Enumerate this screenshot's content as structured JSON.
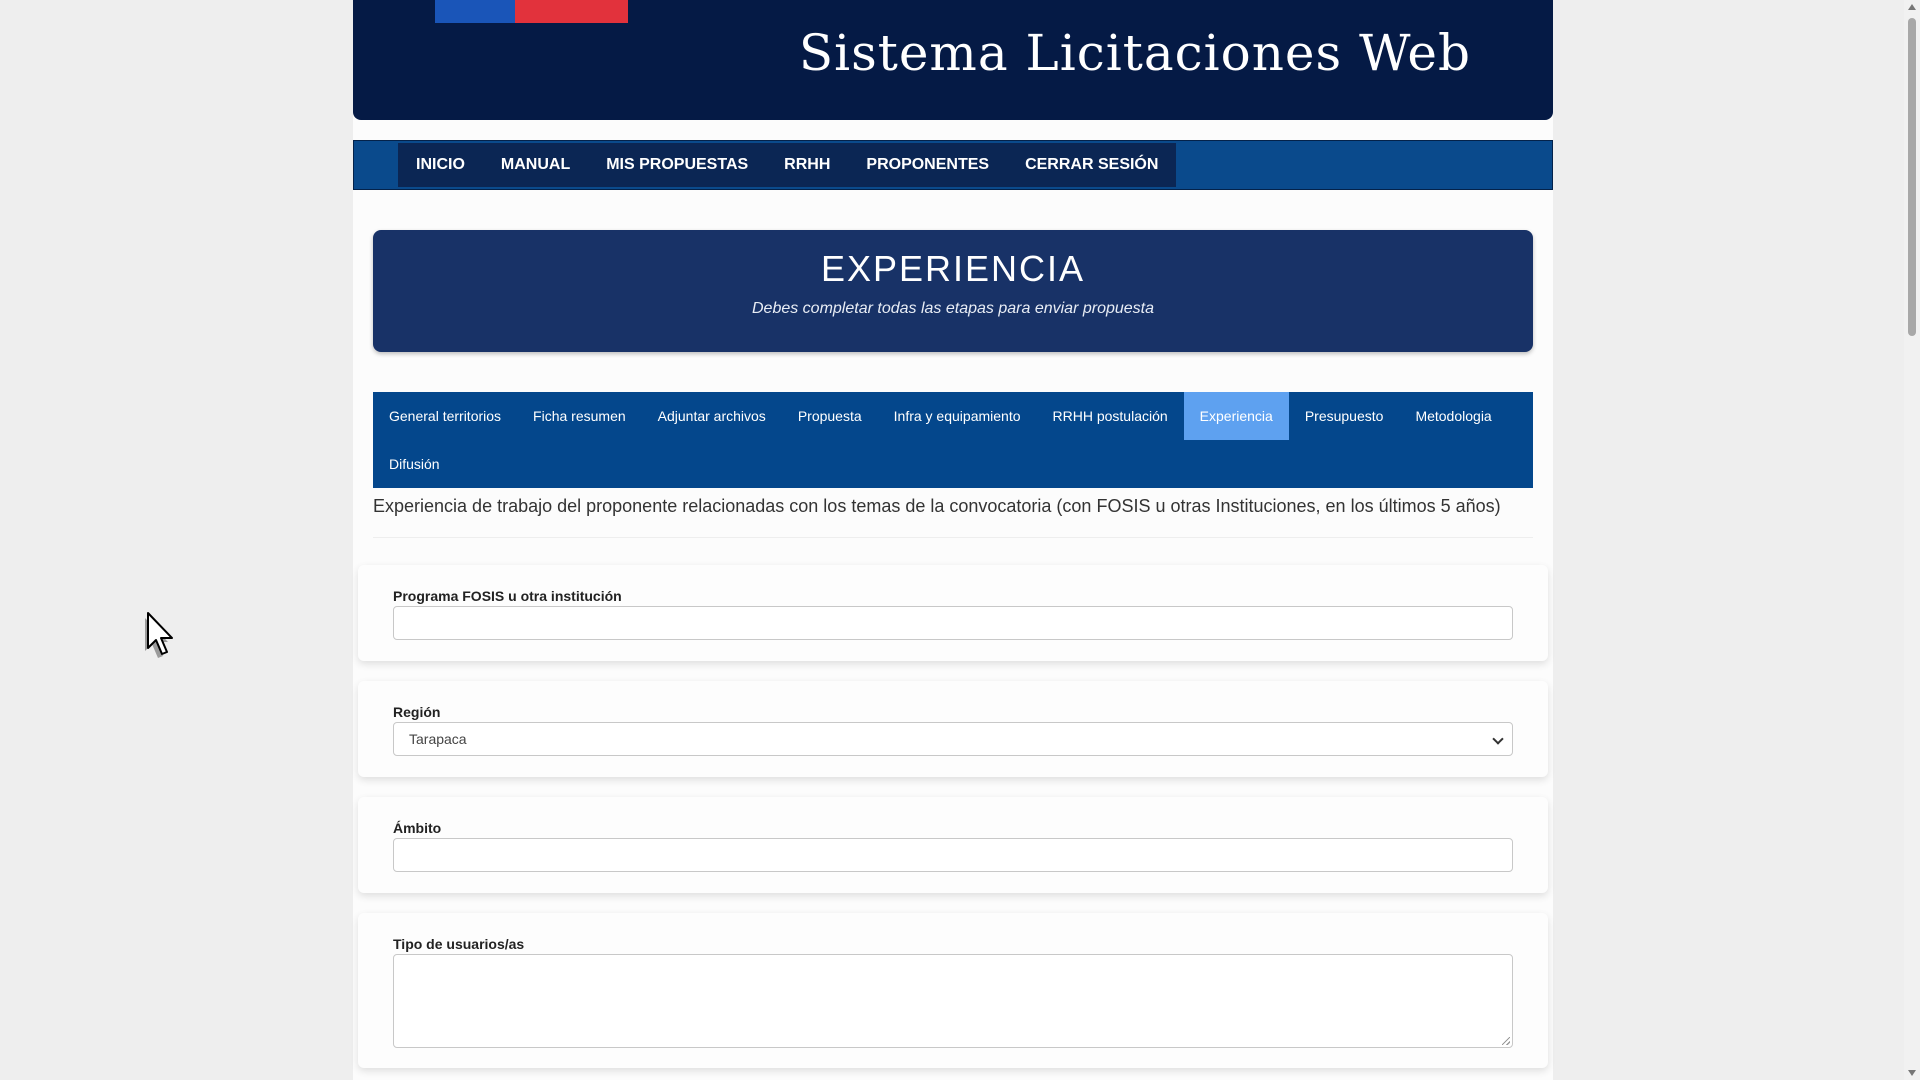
{
  "site": {
    "title": "Sistema Licitaciones Web"
  },
  "nav": {
    "items": [
      {
        "label": "INICIO"
      },
      {
        "label": "MANUAL"
      },
      {
        "label": "MIS PROPUESTAS"
      },
      {
        "label": "RRHH"
      },
      {
        "label": "PROPONENTES"
      },
      {
        "label": "CERRAR SESIÓN"
      }
    ]
  },
  "hero": {
    "title": "EXPERIENCIA",
    "subtitle": "Debes completar todas las etapas para enviar propuesta"
  },
  "tabs": {
    "row1": [
      {
        "label": "General territorios"
      },
      {
        "label": "Ficha resumen"
      },
      {
        "label": "Adjuntar archivos"
      },
      {
        "label": "Propuesta"
      },
      {
        "label": "Infra y equipamiento"
      },
      {
        "label": "RRHH postulación"
      },
      {
        "label": "Experiencia"
      },
      {
        "label": "Presupuesto"
      },
      {
        "label": "Metodologia"
      }
    ],
    "row2": [
      {
        "label": "Difusión"
      }
    ],
    "active": "Experiencia"
  },
  "description": "Experiencia de trabajo del proponente relacionadas con los temas de la convocatoria (con FOSIS u otras Instituciones, en los últimos 5 años)",
  "form": {
    "programa": {
      "label": "Programa FOSIS u otra institución",
      "value": ""
    },
    "region": {
      "label": "Región",
      "value": "Tarapaca"
    },
    "ambito": {
      "label": "Ámbito",
      "value": ""
    },
    "tipo_usuarios": {
      "label": "Tipo de usuarios/as",
      "value": ""
    }
  },
  "colors": {
    "banner": "#051a45",
    "navbar": "#0a4a8c",
    "hero": "#183267",
    "tabs": "#04478c",
    "tab_active": "#5ea1f0",
    "flag_blue": "#1a55b8",
    "flag_red": "#e2323c"
  },
  "icons": {
    "select": "chevron-down-icon",
    "cursor": "mouse-pointer-icon"
  }
}
